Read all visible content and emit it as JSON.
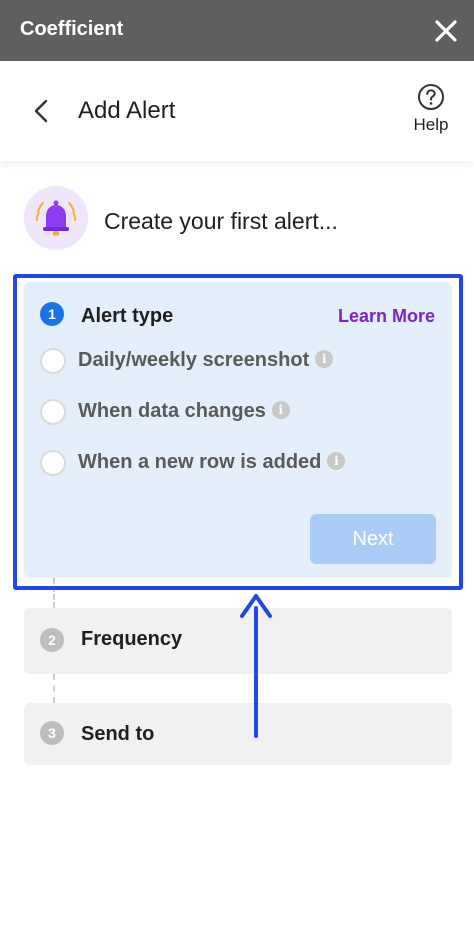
{
  "titlebar": {
    "app_name": "Coefficient"
  },
  "header": {
    "title": "Add Alert",
    "help_label": "Help"
  },
  "intro": {
    "text": "Create your first alert..."
  },
  "steps": {
    "alert_type": {
      "number": "1",
      "title": "Alert type",
      "learn_more": "Learn More",
      "options": [
        {
          "label": "Daily/weekly screenshot"
        },
        {
          "label": "When data changes"
        },
        {
          "label": "When a new row is added"
        }
      ],
      "next_label": "Next"
    },
    "frequency": {
      "number": "2",
      "title": "Frequency"
    },
    "send_to": {
      "number": "3",
      "title": "Send to"
    }
  },
  "info_glyph": "i",
  "colors": {
    "titlebar": "#5f5f5f",
    "active_step_bg": "#e4effb",
    "active_step_number": "#1a73e8",
    "highlight_border": "#2347e6",
    "learn_more": "#7a24c9",
    "next_disabled": "#a9cdf7",
    "bell": "#8b3ff0"
  }
}
